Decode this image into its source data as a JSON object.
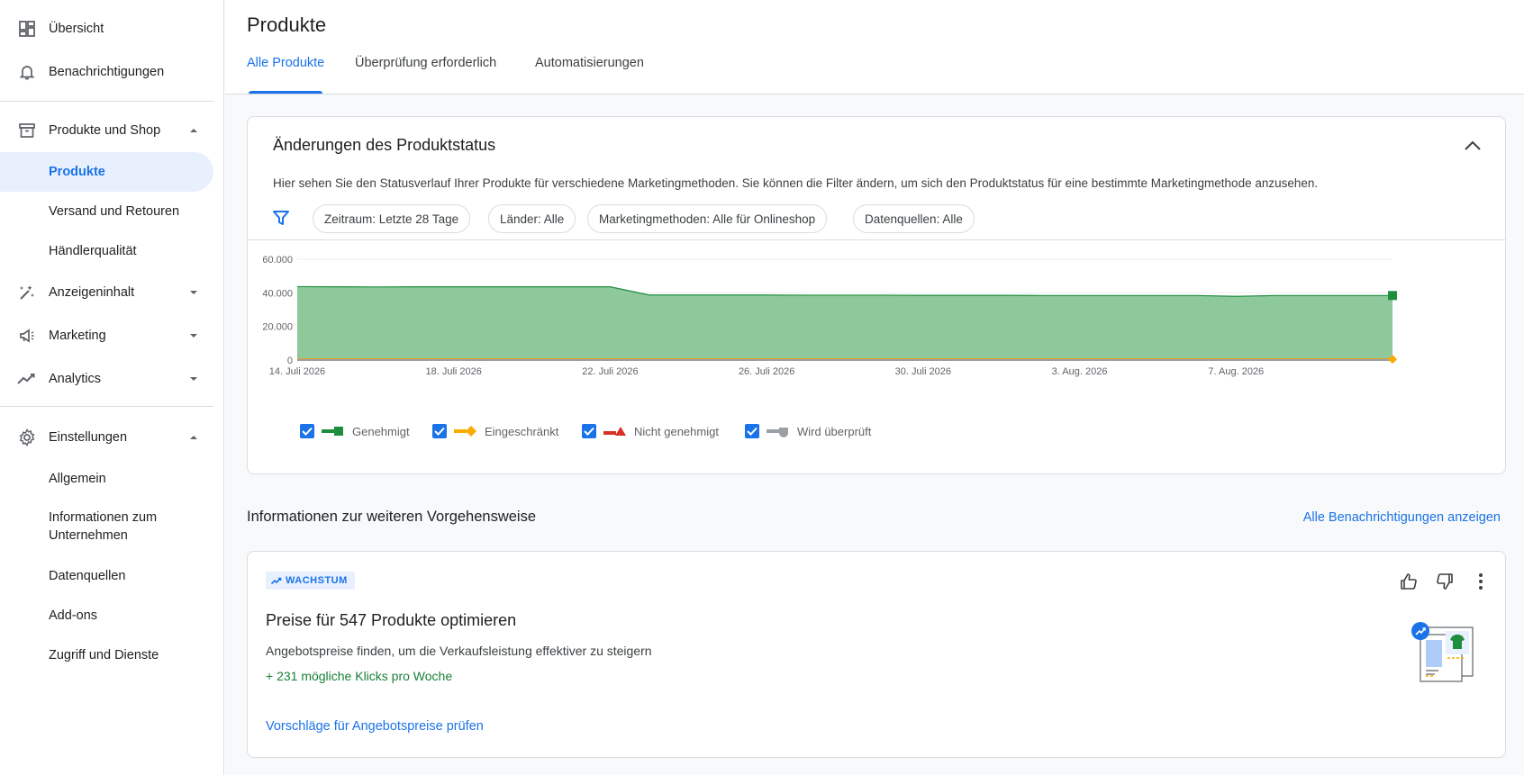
{
  "sidebar": {
    "overview": "Übersicht",
    "notifications": "Benachrichtigungen",
    "products_shop": "Produkte und Shop",
    "products": "Produkte",
    "shipping": "Versand und Retouren",
    "merchant_quality": "Händlerqualität",
    "ad_content": "Anzeigeninhalt",
    "marketing": "Marketing",
    "analytics": "Analytics",
    "settings": "Einstellungen",
    "general": "Allgemein",
    "business_info": "Informationen zum Unternehmen",
    "data_sources": "Datenquellen",
    "addons": "Add-ons",
    "access": "Zugriff und Dienste"
  },
  "page": {
    "title": "Produkte",
    "tabs": [
      "Alle Produkte",
      "Überprüfung erforderlich",
      "Automatisierungen"
    ]
  },
  "status_card": {
    "title": "Änderungen des Produktstatus",
    "description": "Hier sehen Sie den Statusverlauf Ihrer Produkte für verschiedene Marketingmethoden. Sie können die Filter ändern, um sich den Produktstatus für eine bestimmte Marketingmethode anzusehen.",
    "filters": [
      "Zeitraum: Letzte 28 Tage",
      "Länder: Alle",
      "Marketingmethoden: Alle für Onlineshop",
      "Datenquellen: Alle"
    ]
  },
  "chart_data": {
    "type": "area",
    "y_ticks": [
      "60.000",
      "40.000",
      "20.000",
      "0"
    ],
    "ylim": [
      0,
      60000
    ],
    "x_ticks": [
      "14. Juli 2026",
      "18. Juli 2026",
      "22. Juli 2026",
      "26. Juli 2026",
      "30. Juli 2026",
      "3. Aug. 2026",
      "7. Aug. 2026"
    ],
    "x_dates": [
      "2026-07-14",
      "2026-07-15",
      "2026-07-16",
      "2026-07-17",
      "2026-07-18",
      "2026-07-19",
      "2026-07-20",
      "2026-07-21",
      "2026-07-22",
      "2026-07-23",
      "2026-07-24",
      "2026-07-25",
      "2026-07-26",
      "2026-07-27",
      "2026-07-28",
      "2026-07-29",
      "2026-07-30",
      "2026-07-31",
      "2026-08-01",
      "2026-08-02",
      "2026-08-03",
      "2026-08-04",
      "2026-08-05",
      "2026-08-06",
      "2026-08-07",
      "2026-08-08",
      "2026-08-09",
      "2026-08-10",
      "2026-08-11"
    ],
    "series": [
      {
        "name": "Genehmigt",
        "color": "#1e8e3e",
        "fill": "#8ec99b",
        "values": [
          43700,
          43600,
          43500,
          43600,
          43600,
          43600,
          43600,
          43600,
          43600,
          38700,
          38700,
          38700,
          38700,
          38600,
          38600,
          38600,
          38500,
          38500,
          38500,
          38400,
          38400,
          38400,
          38400,
          38400,
          37900,
          38400,
          38400,
          38400,
          38400
        ]
      },
      {
        "name": "Eingeschränkt",
        "color": "#f9ab00",
        "values": [
          500,
          500,
          500,
          500,
          500,
          500,
          500,
          500,
          500,
          500,
          500,
          500,
          500,
          500,
          500,
          500,
          500,
          500,
          500,
          500,
          500,
          500,
          500,
          500,
          500,
          500,
          500,
          500,
          500
        ]
      },
      {
        "name": "Nicht genehmigt",
        "color": "#d93025",
        "values": [
          50,
          50,
          50,
          50,
          50,
          50,
          50,
          50,
          50,
          50,
          50,
          50,
          50,
          50,
          50,
          50,
          50,
          50,
          50,
          50,
          50,
          50,
          50,
          50,
          50,
          50,
          50,
          50,
          50
        ]
      },
      {
        "name": "Wird überprüft",
        "color": "#9aa0a6",
        "values": [
          0,
          0,
          0,
          0,
          0,
          0,
          0,
          0,
          0,
          0,
          0,
          0,
          0,
          0,
          0,
          0,
          0,
          0,
          0,
          0,
          0,
          0,
          0,
          0,
          0,
          0,
          0,
          0,
          0
        ]
      }
    ]
  },
  "next_steps": {
    "title": "Informationen zur weiteren Vorgehensweise",
    "link_all": "Alle Benachrichtigungen anzeigen"
  },
  "recommendation": {
    "badge": "WACHSTUM",
    "title": "Preise für 547 Produkte optimieren",
    "description": "Angebotspreise finden, um die Verkaufsleistung effektiver zu steigern",
    "metric": "+ 231 mögliche Klicks pro Woche",
    "link": "Vorschläge für Angebotspreise prüfen"
  },
  "colors": {
    "accent": "#1a73e8",
    "approved": "#1e8e3e",
    "limited": "#f9ab00",
    "disapproved": "#d93025",
    "pending": "#9aa0a6"
  }
}
